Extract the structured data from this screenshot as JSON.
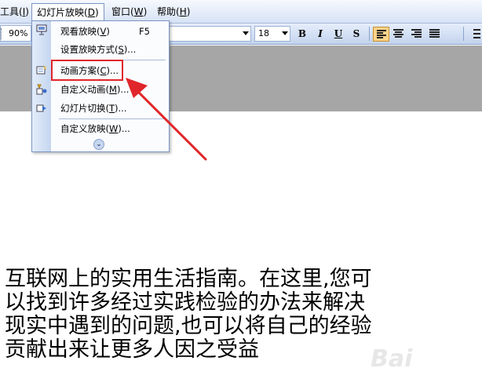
{
  "menubar": {
    "tools": {
      "label": "工具(",
      "key": "I",
      "tail": ")"
    },
    "slideshow": {
      "label": "幻灯片放映(",
      "key": "D",
      "tail": ")"
    },
    "window": {
      "label": "窗口(",
      "key": "W",
      "tail": ")"
    },
    "help": {
      "label": "帮助(",
      "key": "H",
      "tail": ")"
    }
  },
  "toolbar": {
    "zoom": "90%",
    "font_size": "18",
    "bold_label": "B",
    "italic_label": "I",
    "underline_label": "U",
    "shadow_label": "S"
  },
  "dropdown": {
    "items": [
      {
        "label": "观看放映(",
        "key": "V",
        "tail": ")",
        "shortcut": "F5",
        "icon": "slideshow-icon"
      },
      {
        "label": "设置放映方式(",
        "key": "S",
        "tail": ")...",
        "shortcut": "",
        "icon": ""
      },
      {
        "label": "动画方案(",
        "key": "C",
        "tail": ")...",
        "shortcut": "",
        "icon": "animation-scheme-icon"
      },
      {
        "label": "自定义动画(",
        "key": "M",
        "tail": ")...",
        "shortcut": "",
        "icon": "custom-animation-icon"
      },
      {
        "label": "幻灯片切换(",
        "key": "T",
        "tail": ")...",
        "shortcut": "",
        "icon": "slide-transition-icon"
      },
      {
        "label": "自定义放映(",
        "key": "W",
        "tail": ")...",
        "shortcut": "",
        "icon": ""
      }
    ],
    "more_icon": "expand-chevrons-icon"
  },
  "annotation": {
    "highlight_color": "#e0262a"
  },
  "body_text": {
    "lines": [
      "互联网上的实用生活指南。在这里,您可",
      "以找到许多经过实践检验的办法来解决",
      "现实中遇到的问题,也可以将自己的经验",
      "贡献出来让更多人因之受益"
    ]
  },
  "watermark": {
    "text": "Bai"
  }
}
